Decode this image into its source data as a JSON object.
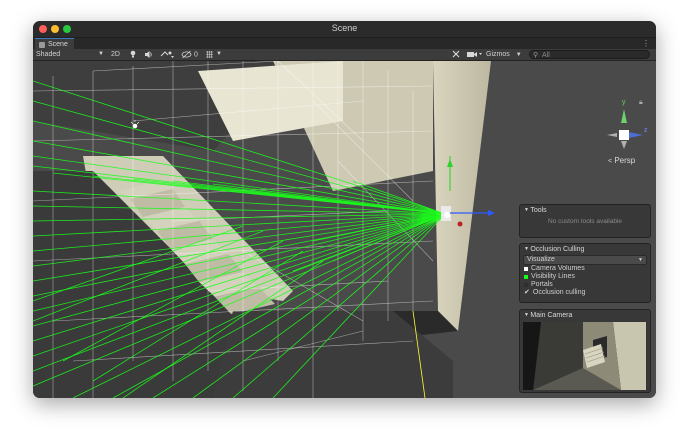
{
  "window": {
    "title": "Scene"
  },
  "tab": {
    "label": "Scene",
    "menu_icon": "kebab-menu-icon"
  },
  "toolbar": {
    "draw_mode": "Shaded",
    "mode_2d": "2D",
    "light_icon": "light-bulb-icon",
    "audio_icon": "speaker-icon",
    "effects_icon": "effects-icon",
    "hidden_count": "0",
    "gizmos_label": "Gizmos",
    "search_placeholder": "All",
    "lock_icon": "lock-icon"
  },
  "scene_gizmo": {
    "y": "y",
    "z": "z",
    "projection": "Persp"
  },
  "tools_panel": {
    "title": "Tools",
    "note": "No custom tools available"
  },
  "occlusion_panel": {
    "title": "Occlusion Culling",
    "mode": "Visualize",
    "options": [
      {
        "label": "Camera Volumes",
        "color": "#ffffff"
      },
      {
        "label": "Visibility Lines",
        "color": "#1aff1a"
      },
      {
        "label": "Portals",
        "color": "#2e2e2e"
      }
    ],
    "toggle_label": "Occlusion culling",
    "toggle_checked": true
  },
  "camera_panel": {
    "title": "Main Camera"
  },
  "colors": {
    "visibility_lines": "#19ff19",
    "volume_lines": "#ffffff",
    "wall": "#cbc7b0",
    "selection_yellow": "#ffff33"
  }
}
